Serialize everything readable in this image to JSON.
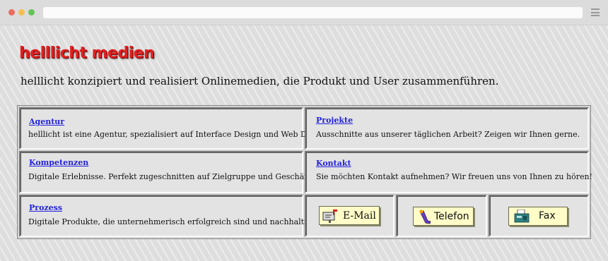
{
  "brand": {
    "name": "helllicht medien",
    "color": "#e02020"
  },
  "tagline": "helllicht konzipiert und realisiert Onlinemedien, die Produkt und User zusammenführen.",
  "sections": [
    {
      "title": "Agentur",
      "text": "helllicht ist eine Agentur, spezialisiert auf Interface Design und Web Development."
    },
    {
      "title": "Projekte",
      "text": "Ausschnitte aus unserer täglichen Arbeit? Zeigen wir Ihnen gerne."
    },
    {
      "title": "Kompetenzen",
      "text": "Digitale Erlebnisse. Perfekt zugeschnitten auf Zielgruppe und Geschäftsmodell."
    },
    {
      "title": "Kontakt",
      "text": "Sie möchten Kontakt aufnehmen? Wir freuen uns von Ihnen zu hören!"
    },
    {
      "title": "Prozess",
      "text": "Digitale Produkte, die unternehmerisch erfolgreich sind und nachhaltigen Wert haben."
    }
  ],
  "contact_buttons": [
    {
      "label": "E-Mail",
      "icon": "mailbox-icon"
    },
    {
      "label": "Telefon",
      "icon": "phone-icon"
    },
    {
      "label": "Fax",
      "icon": "fax-icon"
    }
  ],
  "colors": {
    "link": "#2222dd",
    "button_bg": "#fffcc8",
    "page_bg": "#dedede"
  }
}
